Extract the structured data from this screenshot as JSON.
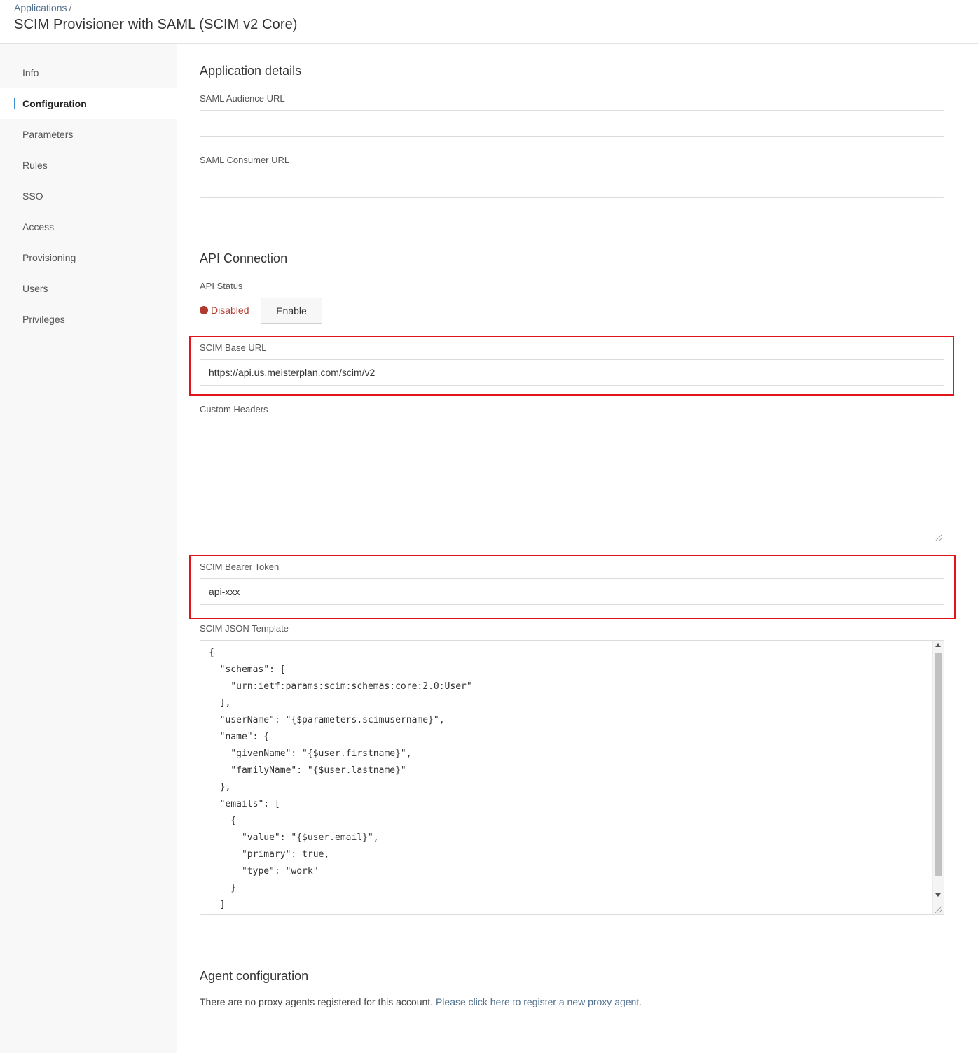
{
  "breadcrumb": {
    "parent": "Applications",
    "separator": "/"
  },
  "page_title": "SCIM Provisioner with SAML (SCIM v2 Core)",
  "sidebar": {
    "items": [
      {
        "label": "Info",
        "active": false
      },
      {
        "label": "Configuration",
        "active": true
      },
      {
        "label": "Parameters",
        "active": false
      },
      {
        "label": "Rules",
        "active": false
      },
      {
        "label": "SSO",
        "active": false
      },
      {
        "label": "Access",
        "active": false
      },
      {
        "label": "Provisioning",
        "active": false
      },
      {
        "label": "Users",
        "active": false
      },
      {
        "label": "Privileges",
        "active": false
      }
    ]
  },
  "app_details": {
    "title": "Application details",
    "saml_audience_label": "SAML Audience URL",
    "saml_audience_value": "",
    "saml_consumer_label": "SAML Consumer URL",
    "saml_consumer_value": ""
  },
  "api_connection": {
    "title": "API Connection",
    "status_label": "API Status",
    "status_text": "Disabled",
    "status_color": "#b03a2e",
    "enable_button": "Enable",
    "scim_base_url_label": "SCIM Base URL",
    "scim_base_url_value": "https://api.us.meisterplan.com/scim/v2",
    "custom_headers_label": "Custom Headers",
    "custom_headers_value": "",
    "bearer_token_label": "SCIM Bearer Token",
    "bearer_token_value": "api-xxx",
    "json_template_label": "SCIM JSON Template",
    "json_template_value": "{\n  \"schemas\": [\n    \"urn:ietf:params:scim:schemas:core:2.0:User\"\n  ],\n  \"userName\": \"{$parameters.scimusername}\",\n  \"name\": {\n    \"givenName\": \"{$user.firstname}\",\n    \"familyName\": \"{$user.lastname}\"\n  },\n  \"emails\": [\n    {\n      \"value\": \"{$user.email}\",\n      \"primary\": true,\n      \"type\": \"work\"\n    }\n  ]"
  },
  "agent_config": {
    "title": "Agent configuration",
    "text": "There are no proxy agents registered for this account.",
    "link_text": "Please click here to register a new proxy agent."
  },
  "colors": {
    "accent": "#3b8fd6",
    "link": "#51718f",
    "highlight": "#e0141a"
  }
}
